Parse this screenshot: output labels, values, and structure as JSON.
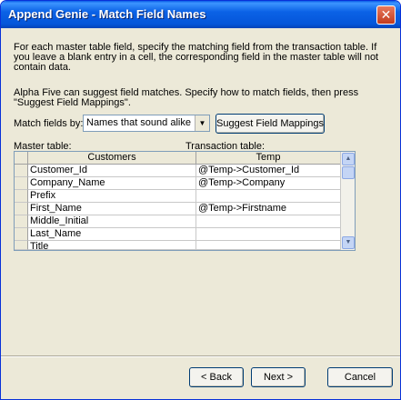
{
  "window": {
    "title": "Append Genie - Match Field Names",
    "close_glyph": "✕"
  },
  "intro": "For each master table field, specify the matching field from the transaction table. If you leave a blank entry in a cell, the corresponding field in the master table will not contain data.",
  "hint": "Alpha Five can suggest field matches. Specify how to match fields, then press \"Suggest Field Mappings\".",
  "match": {
    "label": "Match fields by:",
    "selected": "Names that sound alike"
  },
  "suggest_button": "Suggest Field Mappings",
  "labels": {
    "master": "Master table:",
    "transaction": "Transaction table:"
  },
  "grid": {
    "headers": [
      "Customers",
      "Temp"
    ],
    "rows": [
      [
        "Customer_Id",
        "@Temp->Customer_Id"
      ],
      [
        "Company_Name",
        "@Temp->Company"
      ],
      [
        "Prefix",
        ""
      ],
      [
        "First_Name",
        "@Temp->Firstname"
      ],
      [
        "Middle_Initial",
        ""
      ],
      [
        "Last_Name",
        ""
      ],
      [
        "Title",
        ""
      ]
    ]
  },
  "scroll": {
    "up_icon": "▲",
    "down_icon": "▼"
  },
  "buttons": {
    "back": "< Back",
    "next": "Next >",
    "cancel": "Cancel"
  }
}
